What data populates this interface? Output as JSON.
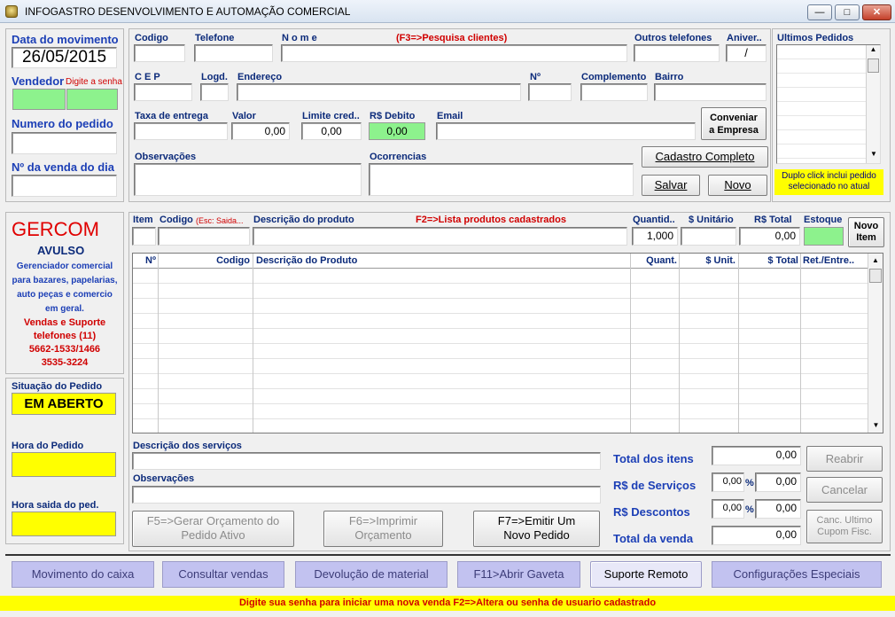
{
  "window": {
    "title": "INFOGASTRO DESENVOLVIMENTO E AUTOMAÇÃO COMERCIAL"
  },
  "left": {
    "data_label": "Data do movimento",
    "data_value": "26/05/2015",
    "vendedor_label": "Vendedor",
    "vendedor_hint": "Digite a senha",
    "pedido_label": "Numero do pedido",
    "venda_dia_label": "Nº da venda do dia"
  },
  "cliente": {
    "codigo": "Codigo",
    "telefone": "Telefone",
    "nome": "N o m e",
    "nome_hint": "(F3=>Pesquisa clientes)",
    "outros_tel": "Outros telefones",
    "aniver": "Aniver..",
    "aniver_value": "/",
    "cep": "C E P",
    "logd": "Logd.",
    "endereco": "Endereço",
    "numero": "Nº",
    "complemento": "Complemento",
    "bairro": "Bairro",
    "taxa": "Taxa de entrega",
    "valor": "Valor",
    "valor_value": "0,00",
    "limite": "Limite cred..",
    "limite_value": "0,00",
    "debito": "R$  Debito",
    "debito_value": "0,00",
    "email": "Email",
    "observacoes": "Observações",
    "ocorrencias": "Ocorrencias",
    "convenio_btn_1": "Conveniar",
    "convenio_btn_2": "a Empresa",
    "cadastro_btn": "Cadastro Completo",
    "salvar_btn": "Salvar",
    "novo_btn": "Novo"
  },
  "ultimos": {
    "label": "Ultimos Pedidos",
    "hint": "Duplo click inclui pedido selecionado no atual"
  },
  "brand": {
    "name": "GERCOM",
    "sub": "AVULSO",
    "desc_1": "Gerenciador  comercial",
    "desc_2": "para bazares, papelarias,",
    "desc_3": "auto  peças  e comercio",
    "desc_4": "em geral.",
    "sup_1": "Vendas e Suporte",
    "sup_2": "telefones (11)",
    "sup_3": "5662-1533/1466",
    "sup_4": "3535-3224"
  },
  "situacao": {
    "label": "Situação do Pedido",
    "value": "EM ABERTO",
    "hora_label": "Hora do Pedido",
    "saida_label": "Hora saida do ped."
  },
  "item": {
    "item": "Item",
    "codigo": "Codigo",
    "codigo_hint": "(Esc: Saida...",
    "descricao": "Descrição do produto",
    "f2_hint": "F2=>Lista produtos cadastrados",
    "quantid": "Quantid..",
    "quantid_value": "1,000",
    "unitario": "$ Unitário",
    "total": "R$ Total",
    "total_value": "0,00",
    "estoque": "Estoque",
    "novo_item_1": "Novo",
    "novo_item_2": "Item"
  },
  "grid": {
    "columns": [
      "Nº",
      "Codigo",
      "Descrição do Produto",
      "Quant.",
      "$ Unit.",
      "$ Total",
      "Ret./Entre.."
    ]
  },
  "bottom": {
    "servicos": "Descrição dos serviços",
    "observacoes": "Observações",
    "f5_1": "F5=>Gerar Orçamento do",
    "f5_2": "Pedido Ativo",
    "f6_1": "F6=>Imprimir",
    "f6_2": "Orçamento",
    "f7_1": "F7=>Emitir Um",
    "f7_2": "Novo Pedido",
    "total_itens": "Total  dos itens",
    "total_itens_value": "0,00",
    "servicos_rs": "R$ de Serviços",
    "servicos_pct": "0,00",
    "servicos_value": "0,00",
    "descontos": "R$   Descontos",
    "descontos_pct": "0,00",
    "descontos_value": "0,00",
    "total_venda": "Total da venda",
    "total_venda_value": "0,00",
    "pct": "%",
    "reabrir": "Reabrir",
    "cancelar": "Cancelar",
    "canc_1": "Canc. Ultimo",
    "canc_2": "Cupom Fisc."
  },
  "toolbar": {
    "movimento": "Movimento do caixa",
    "consultar": "Consultar vendas",
    "devolucao": "Devolução de material",
    "gaveta": "F11>Abrir Gaveta",
    "suporte": "Suporte Remoto",
    "config": "Configurações Especiais"
  },
  "status": "Digite sua senha para iniciar uma nova venda    F2=>Altera ou senha de usuario cadastrado"
}
